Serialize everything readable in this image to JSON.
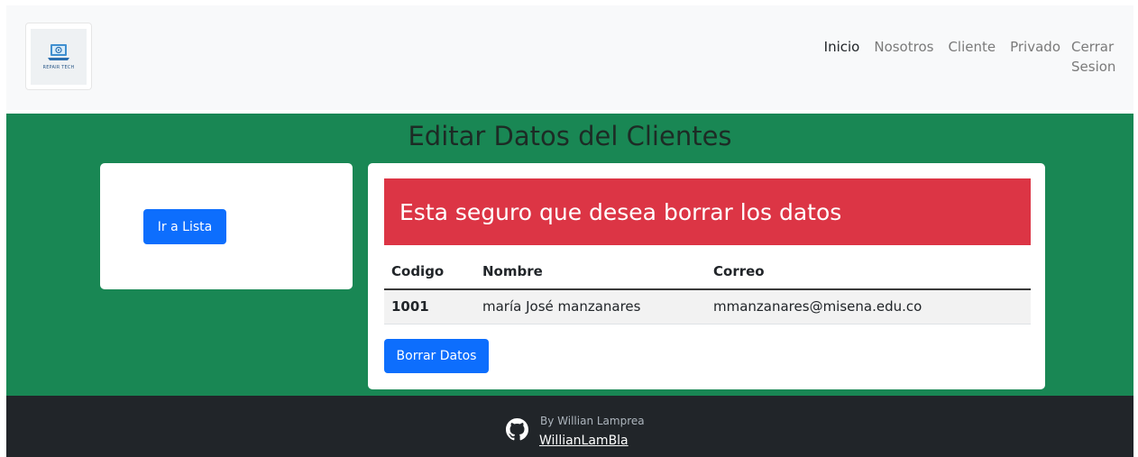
{
  "brand": {
    "logo_text": "REPAIR TECH"
  },
  "nav": {
    "items": [
      {
        "label": "Inicio",
        "active": true
      },
      {
        "label": "Nosotros",
        "active": false
      },
      {
        "label": "Cliente",
        "active": false
      },
      {
        "label": "Privado",
        "active": false
      },
      {
        "label": "Cerrar Sesion",
        "active": false
      }
    ]
  },
  "main": {
    "title": "Editar Datos del Clientes",
    "list_button": "Ir a Lista",
    "confirm_message": "Esta seguro que desea borrar los datos",
    "table": {
      "headers": [
        "Codigo",
        "Nombre",
        "Correo"
      ],
      "rows": [
        [
          "1001",
          "maría José manzanares",
          "mmanzanares@misena.edu.co"
        ]
      ]
    },
    "delete_button": "Borrar Datos"
  },
  "footer": {
    "author_text": "By Willian Lamprea",
    "link_text": "WillianLamBla"
  },
  "colors": {
    "primary": "#0d6efd",
    "success_bg": "#198754",
    "danger": "#dc3545",
    "footer_bg": "#212529",
    "navbar_bg": "#f8f9fa"
  }
}
